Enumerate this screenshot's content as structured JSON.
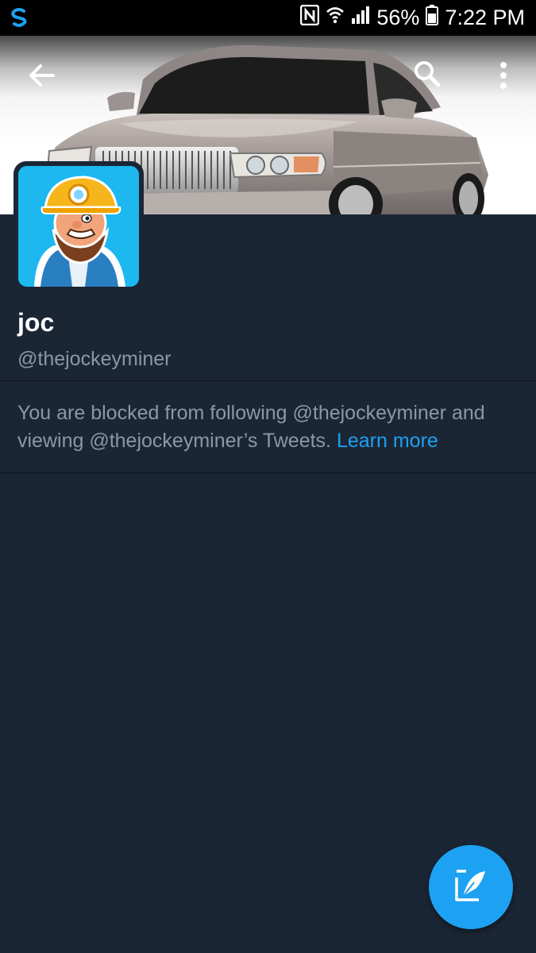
{
  "status_bar": {
    "battery_percent": "56%",
    "time": "7:22 PM",
    "icons": [
      "app-s-icon",
      "nfc-icon",
      "wifi-icon",
      "signal-icon",
      "battery-icon"
    ]
  },
  "header": {
    "icons": [
      "back-arrow-icon",
      "search-icon",
      "more-vert-icon"
    ]
  },
  "profile": {
    "display_name": "joc",
    "handle": "@thejockeyminer"
  },
  "blocked_notice": {
    "line1": "You are blocked from following @thejockeyminer and",
    "line2": "viewing @thejockeyminer’s Tweets.",
    "link": "Learn more"
  },
  "fab": {
    "icon": "compose-tweet-icon"
  },
  "colors": {
    "background": "#1b2635",
    "accent": "#1da1f2",
    "secondary_text": "#8899a6",
    "primary_text": "#ffffff"
  }
}
